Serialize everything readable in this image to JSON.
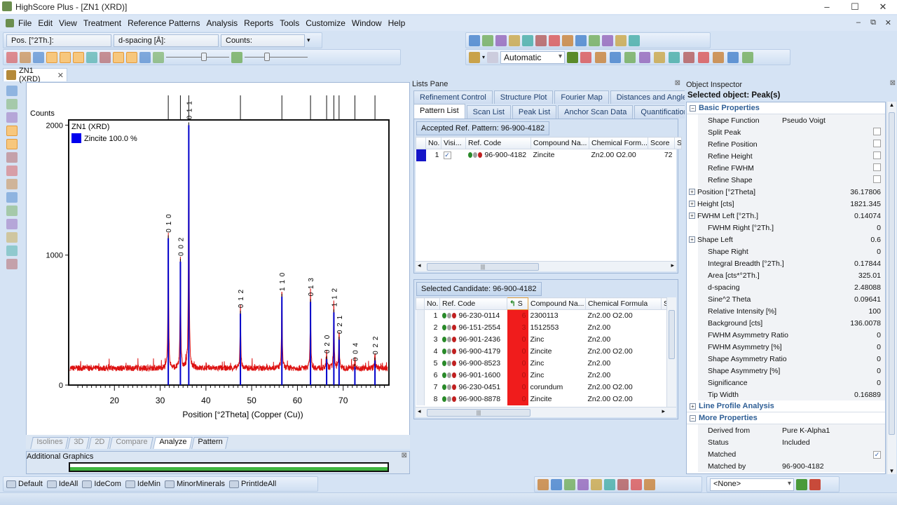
{
  "app": {
    "title": "HighScore Plus - [ZN1 (XRD)]"
  },
  "menu": [
    "File",
    "Edit",
    "View",
    "Treatment",
    "Reference Patterns",
    "Analysis",
    "Reports",
    "Tools",
    "Customize",
    "Window",
    "Help"
  ],
  "status_fields": {
    "position": "Pos. [°2Th.]:",
    "d_spacing": "d-spacing [Å]:",
    "counts": "Counts:"
  },
  "toolbar_right": {
    "mode_combo": "Automatic"
  },
  "toolbar1_icons": [
    "new-document-icon",
    "open-folder-icon",
    "save-icon",
    "export-icon",
    "print-icon",
    "print-preview-icon",
    "print-setup-icon",
    "cut-icon",
    "copy-icon",
    "paste-icon",
    "undo-icon",
    "redo-icon",
    "window-layout-icon"
  ],
  "toolbar2_icons": [
    "peak-search-icon",
    "fit-profile-icon",
    "background-icon",
    "smooth-icon",
    "strip-k-alpha2-icon",
    "search-match-icon",
    "add-peak-icon",
    "refine-icon",
    "pattern-icon",
    "reports-icon",
    "checklist-icon",
    "bar-chart-icon"
  ],
  "toolbar_left_icons": [
    "window-icon",
    "scan-display-icon",
    "stick-pattern-icon",
    "background-fit-icon",
    "peaks-display-icon",
    "profile-display-icon",
    "reference-display-icon",
    "sphere-icon",
    "peak-shape-icon",
    "index-icon",
    "pattern-overlay-icon",
    "phase-icon"
  ],
  "toolbar_left2_icons": [
    "plot-settings-icon"
  ],
  "left_tools": [
    "zoom-in-icon",
    "zoom-out-icon",
    "hand-icon",
    "peak-tool-icon",
    "magnifier-icon",
    "pointer-icon",
    "pencil-icon",
    "eraser-icon",
    "edit-icon",
    "crosshair-icon",
    "options-icon",
    "axis-icon",
    "scale-icon",
    "grid-icon"
  ],
  "document_tab": {
    "label": "ZN1 (XRD)"
  },
  "chart_data": {
    "type": "line",
    "ylabel": "Counts",
    "xlabel": "Position [°2Theta] (Copper (Cu))",
    "xlim": [
      10,
      80
    ],
    "ylim": [
      0,
      2040
    ],
    "xticks": [
      20,
      30,
      40,
      50,
      60,
      70
    ],
    "yticks": [
      0,
      1000,
      2000
    ],
    "legend": {
      "title": "ZN1 (XRD)",
      "entries": [
        {
          "name": "Zincite 100.0 %",
          "color": "#0000ee"
        }
      ],
      "placement": "top-left"
    },
    "background_counts": 130,
    "series": [
      {
        "name": "ZN1 (XRD)",
        "color": "#dd1111"
      },
      {
        "name": "Zincite 100.0 %",
        "color": "#0000cc"
      }
    ],
    "peaks": [
      {
        "x": 31.77,
        "y": 1130,
        "hkl": "0 1 0"
      },
      {
        "x": 34.42,
        "y": 950,
        "hkl": "0 0 2"
      },
      {
        "x": 36.25,
        "y": 2000,
        "hkl": "0 1 1"
      },
      {
        "x": 47.54,
        "y": 550,
        "hkl": "0 1 2"
      },
      {
        "x": 56.6,
        "y": 680,
        "hkl": "1 1 0"
      },
      {
        "x": 62.86,
        "y": 640,
        "hkl": "0 1 3"
      },
      {
        "x": 66.38,
        "y": 200,
        "hkl": "0 2 0"
      },
      {
        "x": 67.96,
        "y": 560,
        "hkl": "1 1 2"
      },
      {
        "x": 69.1,
        "y": 350,
        "hkl": "0 2 1"
      },
      {
        "x": 72.56,
        "y": 140,
        "hkl": "0 0 4"
      },
      {
        "x": 76.95,
        "y": 190,
        "hkl": "0 2 2"
      }
    ]
  },
  "view_tabs": [
    "Isolines",
    "3D",
    "2D",
    "Compare",
    "Analyze",
    "Pattern"
  ],
  "view_tab_active": "Analyze",
  "additional_graphics": {
    "title": "Additional Graphics"
  },
  "lists_pane": {
    "title": "Lists Pane",
    "tabs_row1": [
      "Refinement Control",
      "Structure Plot",
      "Fourier Map",
      "Distances and Angles"
    ],
    "tabs_row2": [
      "Pattern List",
      "Scan List",
      "Peak List",
      "Anchor Scan Data",
      "Quantification"
    ],
    "active_tab": "Pattern List",
    "accepted_label": "Accepted Ref. Pattern: 96-900-4182",
    "accepted_columns": [
      "No.",
      "Visi...",
      "Ref. Code",
      "Compound Na...",
      "Chemical Form...",
      "Score",
      "S"
    ],
    "accepted_rows": [
      {
        "no": "1",
        "visible": true,
        "ref": "96-900-4182",
        "name": "Zincite",
        "formula": "Zn2.00 O2.00",
        "score": "72"
      }
    ],
    "candidate_label": "Selected Candidate: 96-900-4182",
    "candidate_columns": [
      "No.",
      "Ref. Code",
      "S",
      "Compound Na...",
      "Chemical Formula",
      "S"
    ],
    "candidate_rows": [
      {
        "no": "1",
        "ref": "96-230-0114",
        "score": "6",
        "name": "2300113",
        "formula": "Zn2.00 O2.00"
      },
      {
        "no": "2",
        "ref": "96-151-2554",
        "score": "3",
        "name": "1512553",
        "formula": "Zn2.00"
      },
      {
        "no": "3",
        "ref": "96-901-2436",
        "score": "0",
        "name": "Zinc",
        "formula": "Zn2.00"
      },
      {
        "no": "4",
        "ref": "96-900-4179",
        "score": "0",
        "name": "Zincite",
        "formula": "Zn2.00 O2.00"
      },
      {
        "no": "5",
        "ref": "96-900-8523",
        "score": "0",
        "name": "Zinc",
        "formula": "Zn2.00"
      },
      {
        "no": "6",
        "ref": "96-901-1600",
        "score": "0",
        "name": "Zinc",
        "formula": "Zn2.00"
      },
      {
        "no": "7",
        "ref": "96-230-0451",
        "score": "0",
        "name": "corundum",
        "formula": "Zn2.00 O2.00"
      },
      {
        "no": "8",
        "ref": "96-900-8878",
        "score": "0",
        "name": "Zincite",
        "formula": "Zn2.00 O2.00"
      }
    ]
  },
  "inspector": {
    "title": "Object Inspector",
    "selected": "Selected object: Peak(s)",
    "sections": {
      "basic": "Basic Properties",
      "line_profile": "Line Profile Analysis",
      "more": "More Properties"
    },
    "basic": [
      {
        "name": "Shape Function",
        "value": "Pseudo Voigt",
        "kind": "text"
      },
      {
        "name": "Split Peak",
        "kind": "check",
        "checked": false
      },
      {
        "name": "Refine Position",
        "kind": "check",
        "checked": false
      },
      {
        "name": "Refine Height",
        "kind": "check",
        "checked": false
      },
      {
        "name": "Refine FWHM",
        "kind": "check",
        "checked": false
      },
      {
        "name": "Refine Shape",
        "kind": "check",
        "checked": false
      },
      {
        "name": "Position [°2Theta]",
        "value": "36.17806",
        "kind": "num",
        "expand": true
      },
      {
        "name": "Height [cts]",
        "value": "1821.345",
        "kind": "num",
        "expand": true
      },
      {
        "name": "FWHM Left [°2Th.]",
        "value": "0.14074",
        "kind": "num",
        "expand": true
      },
      {
        "name": "FWHM Right [°2Th.]",
        "value": "0",
        "kind": "num"
      },
      {
        "name": "Shape Left",
        "value": "0.6",
        "kind": "num",
        "expand": true
      },
      {
        "name": "Shape Right",
        "value": "0",
        "kind": "num"
      },
      {
        "name": "Integral Breadth [°2Th.]",
        "value": "0.17844",
        "kind": "num"
      },
      {
        "name": "Area [cts*°2Th.]",
        "value": "325.01",
        "kind": "num"
      },
      {
        "name": "d-spacing",
        "value": "2.48088",
        "kind": "num"
      },
      {
        "name": "Sine^2 Theta",
        "value": "0.09641",
        "kind": "num"
      },
      {
        "name": "Relative Intensity [%]",
        "value": "100",
        "kind": "num"
      },
      {
        "name": "Background [cts]",
        "value": "136.0078",
        "kind": "num"
      },
      {
        "name": "FWHM Asymmetry Ratio",
        "value": "0",
        "kind": "num"
      },
      {
        "name": "FWHM Asymmetry [%]",
        "value": "0",
        "kind": "num"
      },
      {
        "name": "Shape Asymmetry Ratio",
        "value": "0",
        "kind": "num"
      },
      {
        "name": "Shape Asymmetry [%]",
        "value": "0",
        "kind": "num"
      },
      {
        "name": "Significance",
        "value": "0",
        "kind": "num"
      },
      {
        "name": "Tip Width",
        "value": "0.16889",
        "kind": "num"
      }
    ],
    "more": [
      {
        "name": "Derived from",
        "value": "Pure K-Alpha1",
        "kind": "text"
      },
      {
        "name": "Status",
        "value": "Included",
        "kind": "text"
      },
      {
        "name": "Matched",
        "kind": "check",
        "checked": true
      },
      {
        "name": "Matched by",
        "value": "96-900-4182",
        "kind": "text"
      }
    ]
  },
  "bottom_toolbar": {
    "presets": [
      "Default",
      "IdeAll",
      "IdeCom",
      "IdeMin",
      "MinorMinerals",
      "PrintIdeAll"
    ],
    "combo": "<None>"
  }
}
